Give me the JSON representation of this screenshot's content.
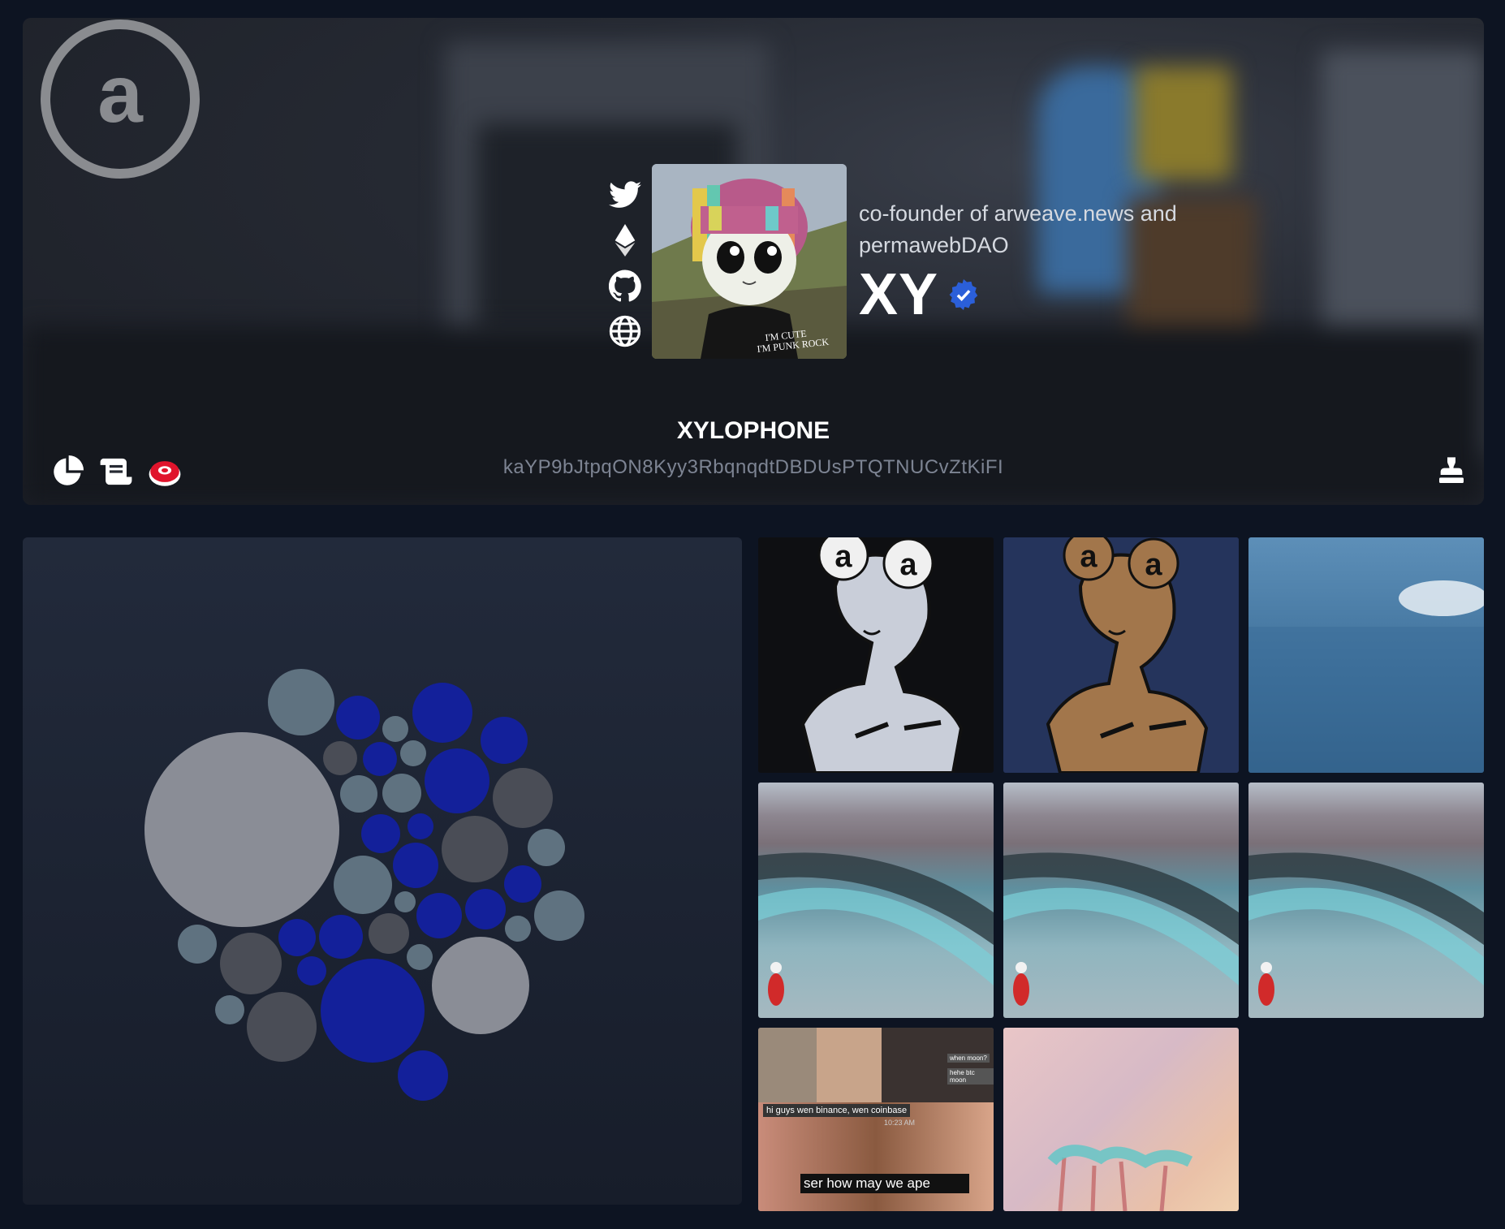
{
  "profile": {
    "bio": "co-founder of arweave.news and permawebDAO",
    "display_name": "XY",
    "handle": "XYLOPHONE",
    "address": "kaYP9bJtpqON8Kyy3RbqnqdtDBDUsPTQTNUCvZtKiFI",
    "verified": true
  },
  "socials": [
    {
      "icon": "twitter-icon"
    },
    {
      "icon": "ethereum-icon"
    },
    {
      "icon": "github-icon"
    },
    {
      "icon": "globe-icon"
    }
  ],
  "tools": [
    {
      "icon": "pie-chart-icon"
    },
    {
      "icon": "scroll-icon"
    },
    {
      "icon": "koii-icon"
    }
  ],
  "avatar_text": "I'M CUTE I'M PUNK ROCK",
  "gallery": {
    "meme_caption_1": "hi guys wen binance, wen coinbase",
    "meme_time": "10:23 AM",
    "meme_bubble_1": "when moon?",
    "meme_bubble_2": "hehe btc moon",
    "meme_caption_2": "ser how may we ape"
  },
  "colors": {
    "accent_blue": "#2b5fd9",
    "bubble_blue": "#13209a",
    "bubble_grey_light": "#8a8d96",
    "bubble_slate": "#5f7280",
    "bubble_dark": "#4a4d56"
  }
}
